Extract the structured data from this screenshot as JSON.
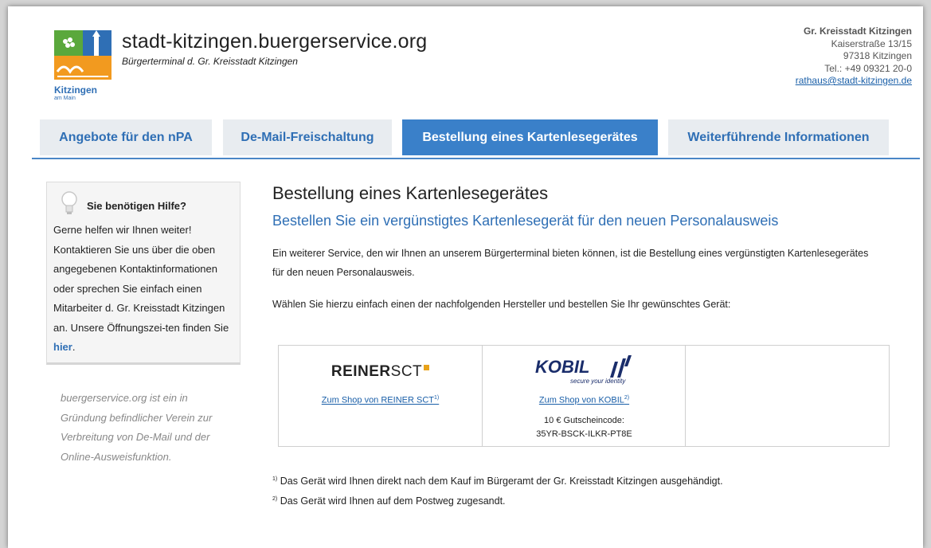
{
  "header": {
    "title": "stadt-kitzingen.buergerservice.org",
    "subtitle": "Bürgerterminal d. Gr. Kreisstadt Kitzingen",
    "logo_text": "Kitzingen",
    "logo_subtext": "am Main",
    "contact": {
      "org": "Gr. Kreisstadt Kitzingen",
      "street": "Kaiserstraße 13/15",
      "city": "97318 Kitzingen",
      "phone": "Tel.: +49 09321 20-0",
      "email": "rathaus@stadt-kitzingen.de"
    }
  },
  "nav": {
    "tabs": [
      {
        "label": "Angebote für den nPA"
      },
      {
        "label": "De-Mail-Freischaltung"
      },
      {
        "label": "Bestellung eines Kartenlesegerätes"
      },
      {
        "label": "Weiterführende Informationen"
      }
    ],
    "active_index": 2
  },
  "sidebar": {
    "help_title": "Sie benötigen Hilfe?",
    "help_text": "Gerne helfen wir Ihnen weiter! Kontaktieren Sie uns über die oben angegebenen Kontaktinformationen oder sprechen Sie einfach einen Mitarbeiter d. Gr. Kreisstadt Kitzingen an. Unsere Öffnungszei-ten finden Sie",
    "help_link": "hier",
    "help_end": ".",
    "note": "buergerservice.org ist ein in Gründung befindlicher Verein zur Verbreitung von De-Mail und der Online-Ausweisfunktion."
  },
  "main": {
    "heading": "Bestellung eines Kartenlesegerätes",
    "subheading": "Bestellen Sie ein vergünstigtes Kartenlesegerät für den neuen Personalausweis",
    "para1": "Ein weiterer Service, den wir Ihnen an unserem Bürgerterminal bieten können, ist die Bestellung eines vergünstigten Kartenlesegerätes für den neuen Personalausweis.",
    "para2": "Wählen Sie hierzu einfach einen der nachfolgenden Hersteller und bestellen Sie Ihr gewünschtes Gerät:",
    "shops": {
      "reiner_brand_bold": "REINER",
      "reiner_brand_light": "SCT",
      "reiner_link": "Zum Shop von REINER SCT",
      "reiner_mark": "1)",
      "kobil_brand": "KOBIL",
      "kobil_tagline": "secure your identity",
      "kobil_link": "Zum Shop von KOBIL",
      "kobil_mark": "2)",
      "coupon_label": "10 € Gutscheincode:",
      "coupon_code": "35YR-BSCK-ILKR-PT8E"
    },
    "footnotes": [
      {
        "mark": "1)",
        "text": "Das Gerät wird Ihnen direkt nach dem Kauf im Bürgeramt der Gr. Kreisstadt Kitzingen ausgehändigt."
      },
      {
        "mark": "2)",
        "text": "Das Gerät wird Ihnen auf dem Postweg zugesandt."
      }
    ]
  },
  "colors": {
    "accent": "#3a80c9",
    "link": "#2f6fb5",
    "tab_bg": "#e8ecf0"
  }
}
